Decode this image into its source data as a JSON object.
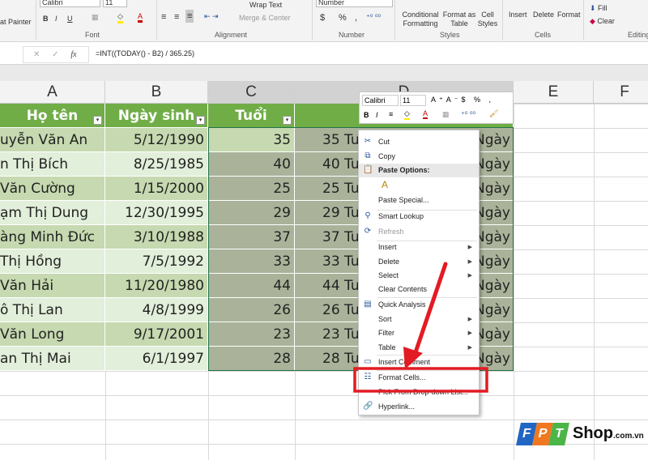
{
  "ribbon": {
    "format_painter": "at Painter",
    "font_name": "Calibri",
    "font_size": "11",
    "bold": "B",
    "italic": "I",
    "underline": "U",
    "wrap_text": "Wrap Text",
    "merge_center": "Merge & Center",
    "number_format": "Number",
    "currency": "$",
    "percent": "%",
    "comma": ",",
    "conditional_formatting": "Conditional Formatting",
    "format_as_table": "Format as Table",
    "cell_styles": "Cell Styles",
    "insert": "Insert",
    "delete": "Delete",
    "format": "Format",
    "fill": "Fill",
    "clear": "Clear",
    "groups": {
      "font": "Font",
      "alignment": "Alignment",
      "number": "Number",
      "styles": "Styles",
      "cells": "Cells",
      "editing": "Editing"
    }
  },
  "formula_bar": {
    "fx": "fx",
    "cancel": "✕",
    "enter": "✓",
    "formula": "=INT((TODAY() - B2) / 365.25)"
  },
  "columns": [
    "A",
    "B",
    "C",
    "D",
    "E",
    "F"
  ],
  "table": {
    "headers": [
      "Họ tên",
      "Ngày sinh",
      "Tuổi"
    ],
    "rows": [
      {
        "name": "uyễn Văn An",
        "dob": "5/12/1990",
        "age": "35",
        "d": "35 Tuổi",
        "d_end": "Ngày"
      },
      {
        "name": "n Thị Bích",
        "dob": "8/25/1985",
        "age": "40",
        "d": "40 Tuổi",
        "d_end": "Ngày"
      },
      {
        "name": "Văn Cường",
        "dob": "1/15/2000",
        "age": "25",
        "d": "25 Tuổi",
        "d_end": "Ngày"
      },
      {
        "name": "ạm Thị Dung",
        "dob": "12/30/1995",
        "age": "29",
        "d": "29 Tuổi",
        "d_end": "Ngày"
      },
      {
        "name": "àng Minh Đức",
        "dob": "3/10/1988",
        "age": "37",
        "d": "37 Tuổi",
        "d_end": "Ngày"
      },
      {
        "name": "Thị Hồng",
        "dob": "7/5/1992",
        "age": "33",
        "d": "33 Tuổi",
        "d_end": "Ngày"
      },
      {
        "name": "Văn Hải",
        "dob": "11/20/1980",
        "age": "44",
        "d": "44 Tuổi",
        "d_end": "Ngày"
      },
      {
        "name": "ô Thị Lan",
        "dob": "4/8/1999",
        "age": "26",
        "d": "26 Tuổi",
        "d_end": "Ngày"
      },
      {
        "name": "Văn Long",
        "dob": "9/17/2001",
        "age": "23",
        "d": "23 Tuổi",
        "d_end": "Ngày"
      },
      {
        "name": "an Thị Mai",
        "dob": "6/1/1997",
        "age": "28",
        "d": "28 Tuổi",
        "d_end": "Ngày"
      }
    ]
  },
  "mini_toolbar": {
    "font": "Calibri",
    "size": "11",
    "bold": "B",
    "italic": "I"
  },
  "context_menu": {
    "cut": "Cut",
    "copy": "Copy",
    "paste_options": "Paste Options:",
    "paste_special": "Paste Special...",
    "smart_lookup": "Smart Lookup",
    "refresh": "Refresh",
    "insert": "Insert",
    "delete": "Delete",
    "select": "Select",
    "clear_contents": "Clear Contents",
    "quick_analysis": "Quick Analysis",
    "sort": "Sort",
    "filter": "Filter",
    "table": "Table",
    "insert_comment": "Insert Comment",
    "format_cells": "Format Cells...",
    "pick_list": "Pick From Drop-down List...",
    "hyperlink": "Hyperlink..."
  },
  "logo": {
    "brand": "FPT",
    "shop": "Shop",
    "domain": ".com.vn"
  },
  "colors": {
    "header_green": "#70ad47",
    "band_dark": "#c6d9b0",
    "band_light": "#e2efda",
    "selected_fill": "#aab39a",
    "highlight_red": "#e31b23"
  }
}
